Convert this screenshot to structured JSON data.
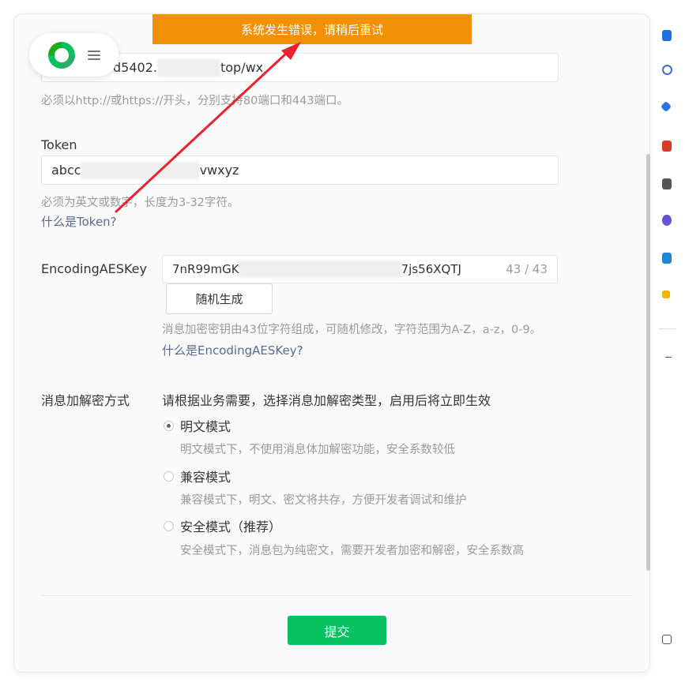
{
  "toast": {
    "message": "系统发生错误，请稍后重试"
  },
  "url": {
    "value_prefix": "d5402.",
    "value_suffix": "top/wx",
    "hint": "必须以http://或https://开头，分别支持80端口和443端口。"
  },
  "token": {
    "label": "Token",
    "value_prefix": "abcc",
    "value_suffix": "vwxyz",
    "hint": "必须为英文或数字，长度为3-32字符。",
    "help_link": "什么是Token?"
  },
  "aes": {
    "label": "EncodingAESKey",
    "value_prefix": "7nR99mGK",
    "value_suffix": "7js56XQTJ",
    "counter": "43 / 43",
    "random_button": "随机生成",
    "hint": "消息加密密钥由43位字符组成，可随机修改，字符范围为A-Z，a-z，0-9。",
    "help_link": "什么是EncodingAESKey?"
  },
  "encryption": {
    "label": "消息加解密方式",
    "intro": "请根据业务需要，选择消息加解密类型，启用后将立即生效",
    "options": [
      {
        "label": "明文模式",
        "desc": "明文模式下，不使用消息体加解密功能，安全系数较低",
        "selected": true
      },
      {
        "label": "兼容模式",
        "desc": "兼容模式下，明文、密文将共存，方便开发者调试和维护",
        "selected": false
      },
      {
        "label": "安全模式（推荐）",
        "desc": "安全模式下，消息包为纯密文，需要开发者加密和解密，安全系数高",
        "selected": false
      }
    ]
  },
  "submit_label": "提交",
  "colors": {
    "toast": "#f29106",
    "primary": "#07c160",
    "link": "#576b95",
    "annotation_arrow": "#e8232f"
  }
}
